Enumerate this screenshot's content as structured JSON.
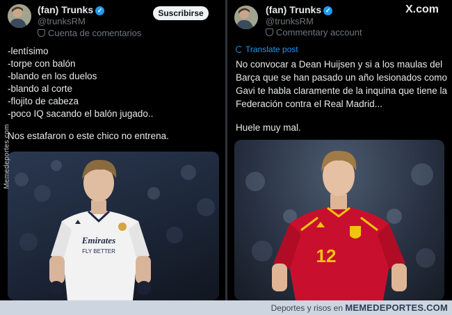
{
  "left_post": {
    "author_name": "(fan) Trunks",
    "handle": "@trunksRM",
    "account_label": "Cuenta de comentarios",
    "subscribe_label": "Suscribirse",
    "lines": [
      "-lentísimo",
      "-torpe con balón",
      "-blando en los duelos",
      "-blando al corte",
      "-flojito de cabeza",
      "-poco IQ sacando el balón jugado..",
      "",
      "Nos estafaron o este chico no entrena."
    ],
    "photo_jersey_text": [
      "Emirates",
      "FLY BETTER"
    ],
    "icons": [
      "avatar",
      "verified-badge-icon",
      "commentary-badge-icon"
    ]
  },
  "right_post": {
    "author_name": "(fan) Trunks",
    "handle": "@trunksRM",
    "account_label": "Commentary account",
    "platform_logo": "X.com",
    "translate_label": "Translate post",
    "lines": [
      "No convocar a Dean Huijsen y si a los maulas del",
      "Barça que se han pasado un año lesionados como",
      "Gavi te habla claramente de la inquina que tiene la",
      "Federación contra el Real Madrid...",
      "",
      "Huele muy mal."
    ],
    "photo_jersey_number": "12",
    "icons": [
      "avatar",
      "verified-badge-icon",
      "commentary-badge-icon",
      "x-logo-icon",
      "translate-icon"
    ]
  },
  "watermark": {
    "side_text": "Memedeportes.com",
    "footer_prefix": "Deportes y risos en",
    "footer_brand": "MEMEDEPORTES.COM"
  },
  "colors": {
    "background": "#000000",
    "verified_blue": "#1d9bf0",
    "muted_text": "#71767b",
    "madrid_white": "#f2f2f2",
    "spain_red": "#c8102e"
  }
}
